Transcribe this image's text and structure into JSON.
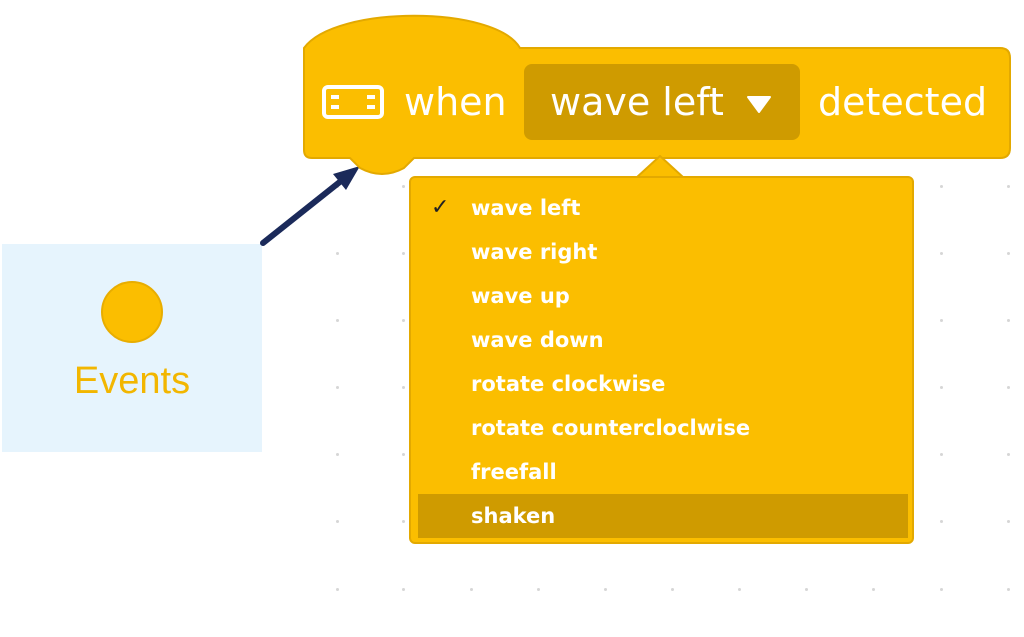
{
  "category": {
    "label": "Events",
    "color": "#fbbe00"
  },
  "hat_block": {
    "icon": "distance-sensor-icon",
    "when_label": "when",
    "detected_label": "detected",
    "dropdown_value": "wave left",
    "color": "#fbbe00",
    "dropdown_color": "#cf9b00"
  },
  "dropdown_menu": {
    "items": [
      {
        "label": "wave left",
        "checked": true
      },
      {
        "label": "wave right"
      },
      {
        "label": "wave up"
      },
      {
        "label": "wave down"
      },
      {
        "label": "rotate clockwise"
      },
      {
        "label": "rotate countercloclwise"
      },
      {
        "label": "freefall"
      },
      {
        "label": "shaken",
        "highlighted": true
      }
    ],
    "check_glyph": "✓"
  },
  "arrow": {
    "color": "#1b2a5a"
  }
}
